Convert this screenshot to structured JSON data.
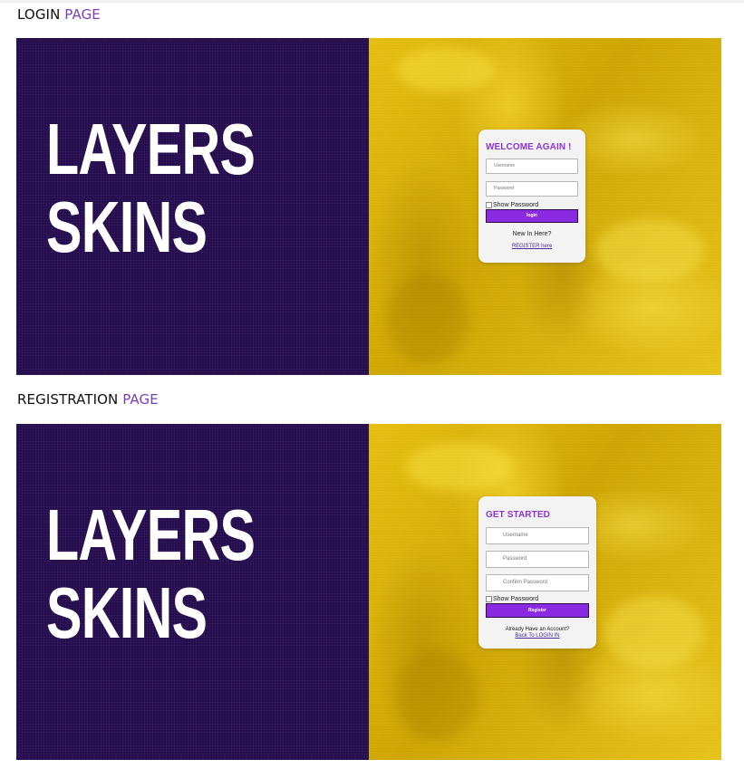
{
  "login_section": {
    "heading_prefix": "LOGIN",
    "heading_accent": "PAGE",
    "brand": {
      "line1": "LAYERS",
      "line2": "SKINS"
    },
    "card": {
      "title": "WELCOME AGAIN !",
      "username_placeholder": "Username",
      "password_placeholder": "Password",
      "show_password_label": "Show Password",
      "submit_label": "login",
      "prompt": "New In Here?",
      "link_label": "REGISTER here"
    }
  },
  "registration_section": {
    "heading_prefix": "REGISTRATION",
    "heading_accent": "PAGE",
    "brand": {
      "line1": "LAYERS",
      "line2": "SKINS"
    },
    "card": {
      "title": "GET STARTED",
      "username_placeholder": "Username",
      "password_placeholder": "Password",
      "confirm_password_placeholder": "Confirm Password",
      "show_password_label": "Show Password",
      "submit_label": "Register",
      "prompt": "Already Have an Account?",
      "link_label": "Back To LOGIN IN"
    }
  },
  "colors": {
    "brand_panel": "#230b4e",
    "backdrop": "#d9b208",
    "accent": "#8a34d6",
    "button": "#8a2be2",
    "heading_accent": "#7a3fb0"
  }
}
